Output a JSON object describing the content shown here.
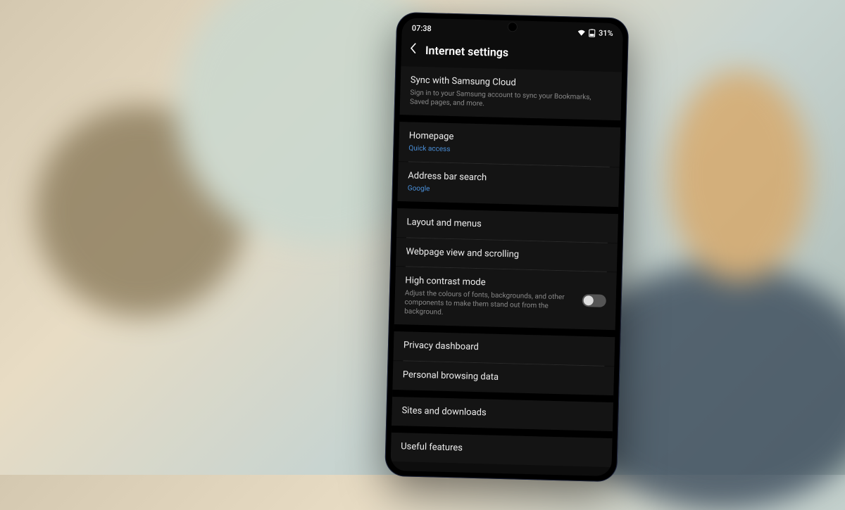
{
  "statusbar": {
    "time": "07:38",
    "battery_percent": "31%"
  },
  "header": {
    "title": "Internet settings"
  },
  "groups": [
    {
      "items": [
        {
          "title": "Sync with Samsung Cloud",
          "sub": "Sign in to your Samsung account to sync your Bookmarks, Saved pages, and more.",
          "link": false
        }
      ]
    },
    {
      "items": [
        {
          "title": "Homepage",
          "sub": "Quick access",
          "link": true
        },
        {
          "title": "Address bar search",
          "sub": "Google",
          "link": true
        }
      ]
    },
    {
      "items": [
        {
          "title": "Layout and menus"
        },
        {
          "title": "Webpage view and scrolling"
        },
        {
          "title": "High contrast mode",
          "sub": "Adjust the colours of fonts, backgrounds, and other components to make them stand out from the background.",
          "toggle": true
        }
      ]
    },
    {
      "items": [
        {
          "title": "Privacy dashboard"
        },
        {
          "title": "Personal browsing data"
        }
      ]
    },
    {
      "items": [
        {
          "title": "Sites and downloads"
        }
      ]
    },
    {
      "items": [
        {
          "title": "Useful features"
        }
      ]
    }
  ]
}
